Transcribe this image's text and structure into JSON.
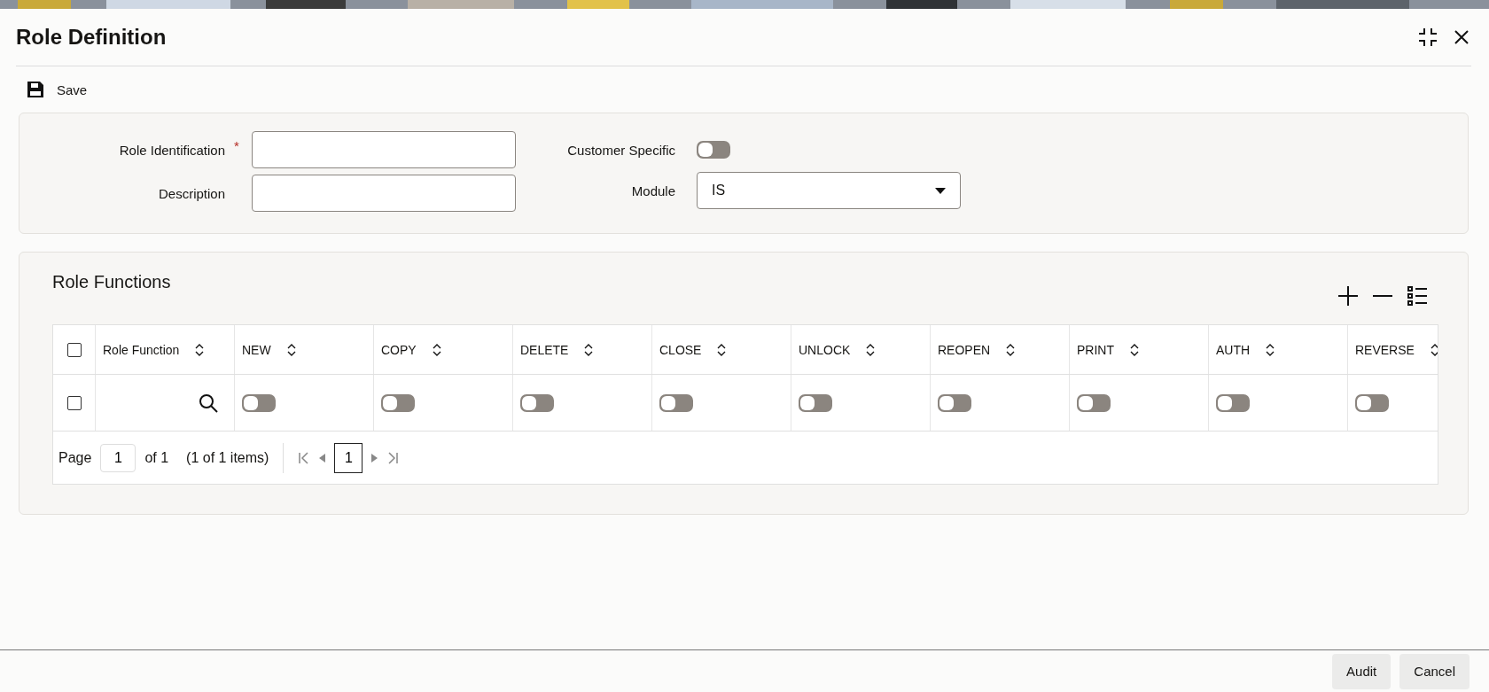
{
  "header": {
    "title": "Role Definition"
  },
  "toolbar": {
    "save": "Save"
  },
  "form": {
    "role_identification": {
      "label": "Role Identification",
      "required_mark": "*"
    },
    "description": {
      "label": "Description"
    },
    "customer_specific": {
      "label": "Customer Specific",
      "on": false
    },
    "module": {
      "label": "Module",
      "value": "IS"
    }
  },
  "role_functions": {
    "title": "Role Functions",
    "header_checked": false,
    "columns": [
      "Role Function",
      "NEW",
      "COPY",
      "DELETE",
      "CLOSE",
      "UNLOCK",
      "REOPEN",
      "PRINT",
      "AUTH",
      "REVERSE"
    ],
    "rows": [
      {
        "checked": false,
        "toggles": [
          {
            "on": false
          },
          {
            "on": false
          },
          {
            "on": false
          },
          {
            "on": false
          },
          {
            "on": false
          },
          {
            "on": false
          },
          {
            "on": false
          },
          {
            "on": false
          },
          {
            "on": false
          }
        ]
      }
    ],
    "pagination": {
      "page_label": "Page",
      "page": "1",
      "of": "of 1",
      "items": "(1 of 1 items)",
      "current": "1"
    }
  },
  "footer": {
    "buttons": [
      "Audit",
      "Cancel"
    ]
  }
}
